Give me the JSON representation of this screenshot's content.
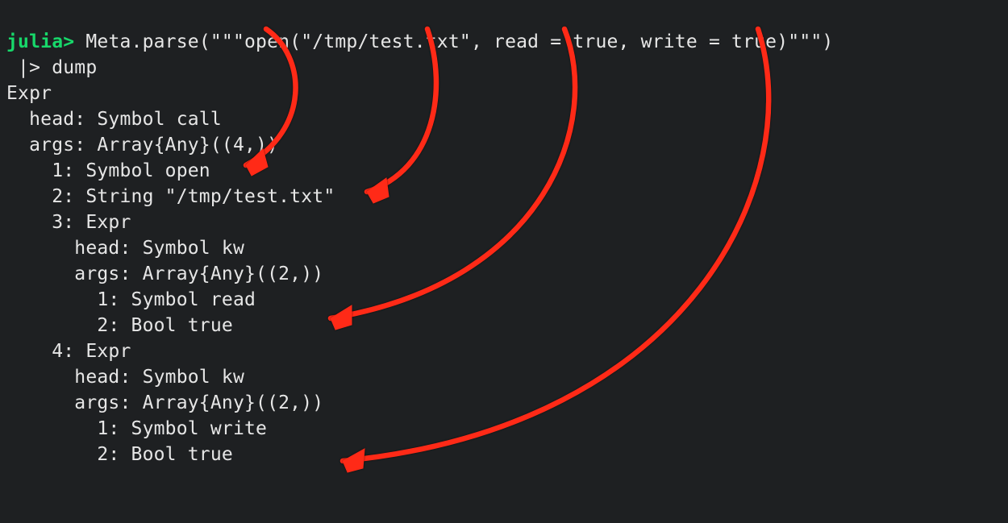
{
  "repl": {
    "prompt": "julia>",
    "input_line1": " Meta.parse(\"\"\"open(\"/tmp/test.txt\", read = true, write = true)\"\"\")",
    "input_line2": " |> dump",
    "output": {
      "l1": "Expr",
      "l2": "  head: Symbol call",
      "l3": "  args: Array{Any}((4,))",
      "l4": "    1: Symbol open",
      "l5": "    2: String \"/tmp/test.txt\"",
      "l6": "    3: Expr",
      "l7": "      head: Symbol kw",
      "l8": "      args: Array{Any}((2,))",
      "l9": "        1: Symbol read",
      "l10": "        2: Bool true",
      "l11": "    4: Expr",
      "l12": "      head: Symbol kw",
      "l13": "      args: Array{Any}((2,))",
      "l14": "        1: Symbol write",
      "l15": "        2: Bool true"
    }
  },
  "annotations": {
    "arrows": [
      {
        "from": "open",
        "to": "Symbol open"
      },
      {
        "from": "/tmp/test.txt",
        "to": "String /tmp/test.txt"
      },
      {
        "from": "read",
        "to": "Symbol read"
      },
      {
        "from": "write",
        "to": "Symbol write"
      }
    ],
    "color": "#ff2a17"
  }
}
